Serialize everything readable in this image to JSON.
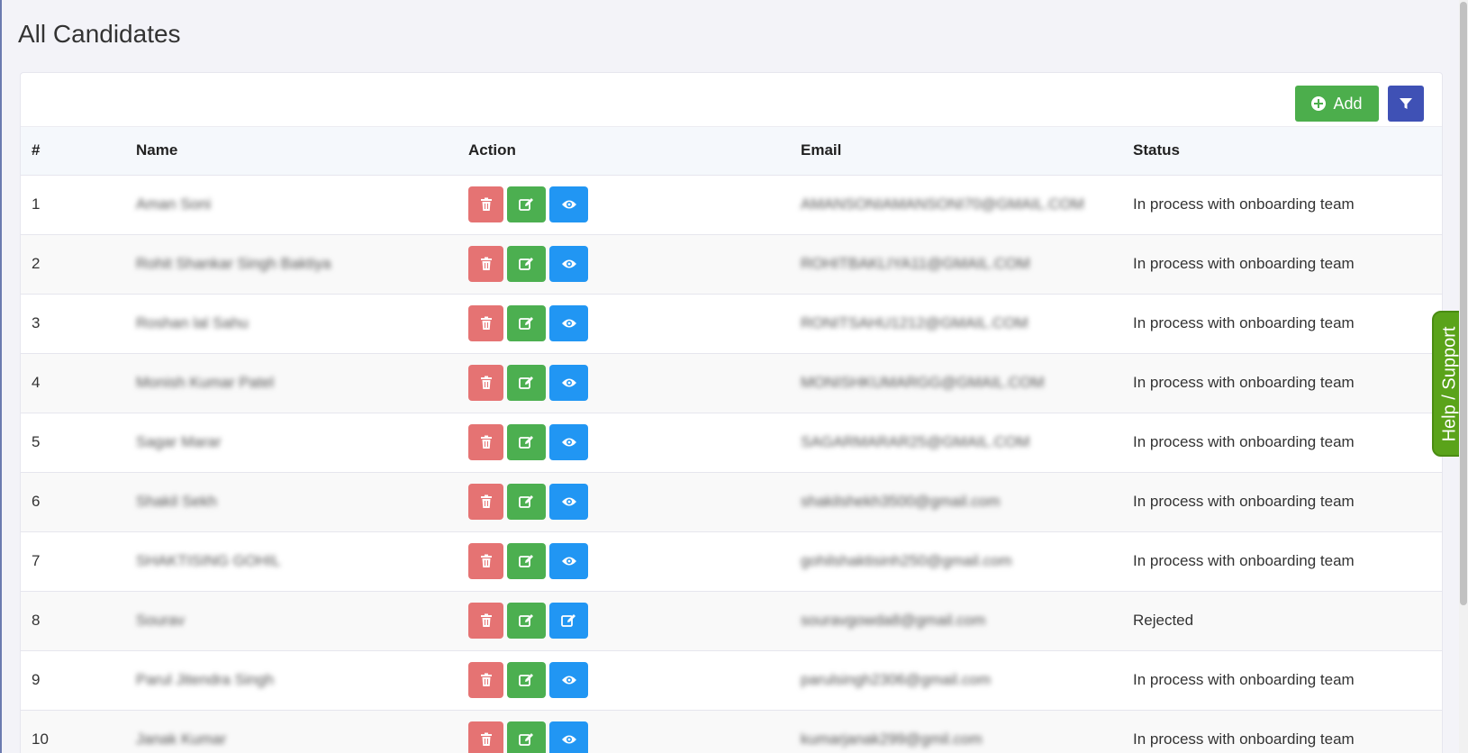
{
  "page_title": "All Candidates",
  "toolbar": {
    "add_label": "Add",
    "add_icon": "plus-circle-icon",
    "filter_icon": "filter-icon"
  },
  "table": {
    "headers": [
      "#",
      "Name",
      "Action",
      "Email",
      "Status"
    ],
    "rows": [
      {
        "num": "1",
        "name": "Aman Soni",
        "email": "AMANSONIAMANSONI70@GMAIL.COM",
        "status": "In process with onboarding team",
        "third_action": "view"
      },
      {
        "num": "2",
        "name": "Rohit Shankar Singh Baktiya",
        "email": "ROHITBAKLIYA11@GMAIL.COM",
        "status": "In process with onboarding team",
        "third_action": "view"
      },
      {
        "num": "3",
        "name": "Roshan lal Sahu",
        "email": "RONITSAHU1212@GMAIL.COM",
        "status": "In process with onboarding team",
        "third_action": "view"
      },
      {
        "num": "4",
        "name": "Monish Kumar Patel",
        "email": "MONISHKUMARGG@GMAIL.COM",
        "status": "In process with onboarding team",
        "third_action": "view"
      },
      {
        "num": "5",
        "name": "Sagar Marar",
        "email": "SAGARMARAR25@GMAIL.COM",
        "status": "In process with onboarding team",
        "third_action": "view"
      },
      {
        "num": "6",
        "name": "Shakil Sekh",
        "email": "shakilshekh3500@gmail.com",
        "status": "In process with onboarding team",
        "third_action": "view"
      },
      {
        "num": "7",
        "name": "SHAKTISING GOHIL",
        "email": "gohilshaktisinh250@gmail.com",
        "status": "In process with onboarding team",
        "third_action": "view"
      },
      {
        "num": "8",
        "name": "Sourav",
        "email": "souravgowda8@gmail.com",
        "status": "Rejected",
        "third_action": "edit"
      },
      {
        "num": "9",
        "name": "Parul Jitendra Singh",
        "email": "parulsingh2306@gmail.com",
        "status": "In process with onboarding team",
        "third_action": "view"
      },
      {
        "num": "10",
        "name": "Janak Kumar",
        "email": "kumarjanak299@gmil.com",
        "status": "In process with onboarding team",
        "third_action": "view"
      }
    ]
  },
  "help_tab": "Help / Support",
  "colors": {
    "add": "#4cae4c",
    "filter": "#3f51b5",
    "delete": "#e57373",
    "edit": "#4caf50",
    "view": "#2196f3",
    "help": "#5aa31a"
  }
}
